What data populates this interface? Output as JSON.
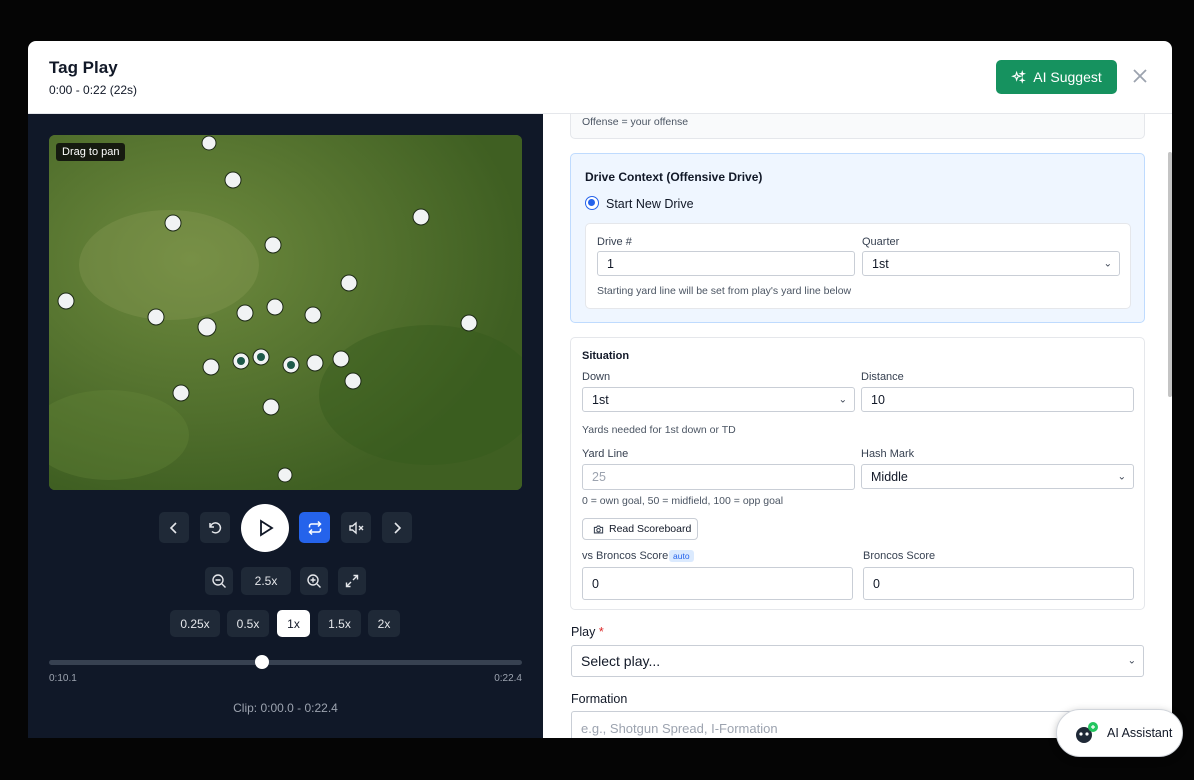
{
  "modal": {
    "title": "Tag Play",
    "subtitle": "0:00 - 0:22 (22s)",
    "ai_suggest_label": "AI Suggest"
  },
  "video": {
    "drag_hint": "Drag to pan",
    "zoom_level": "2.5x",
    "speeds": [
      "0.25x",
      "0.5x",
      "1x",
      "1.5x",
      "2x"
    ],
    "active_speed": "1x",
    "time_current": "0:10.1",
    "time_end": "0:22.4",
    "progress_fraction": 0.45,
    "clip_label": "Clip: 0:00.0 - 0:22.4"
  },
  "form": {
    "offense_hint": "Offense = your offense",
    "drive": {
      "heading": "Drive Context (Offensive Drive)",
      "radio_label": "Start New Drive",
      "drive_num_label": "Drive #",
      "drive_num_value": "1",
      "quarter_label": "Quarter",
      "quarter_value": "1st",
      "yard_hint": "Starting yard line will be set from play's yard line below"
    },
    "situation": {
      "heading": "Situation",
      "down_label": "Down",
      "down_value": "1st",
      "distance_label": "Distance",
      "distance_value": "10",
      "distance_hint": "Yards needed for 1st down or TD",
      "yard_line_label": "Yard Line",
      "yard_line_placeholder": "25",
      "hash_label": "Hash Mark",
      "hash_value": "Middle",
      "yard_line_hint": "0 = own goal, 50 = midfield, 100 = opp goal",
      "scoreboard_button": "Read Scoreboard",
      "opp_score_label": "vs Broncos Score",
      "auto_badge": "auto",
      "opp_score_value": "0",
      "team_score_label": "Broncos Score",
      "team_score_value": "0"
    },
    "play_label": "Play",
    "play_required": "*",
    "play_placeholder": "Select play...",
    "formation_label": "Formation",
    "formation_placeholder": "e.g., Shotgun Spread, I-Formation"
  },
  "assistant_label": "AI Assistant",
  "colors": {
    "accent_green": "#16925f",
    "accent_blue": "#2563eb",
    "video_bg": "#101828"
  }
}
